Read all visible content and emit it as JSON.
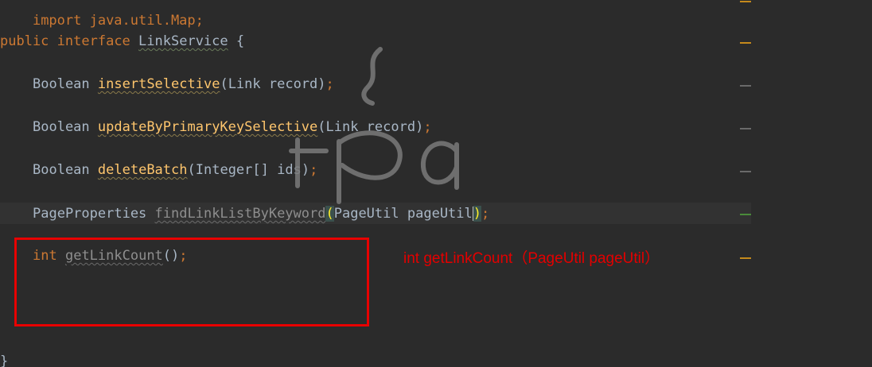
{
  "code": {
    "import_line": "import java.util.Map;",
    "decl": {
      "kw_public": "public",
      "kw_interface": "interface",
      "name": "LinkService",
      "brace": "{"
    },
    "m1": {
      "ret": "Boolean",
      "name": "insertSelective",
      "params": "Link record",
      "semi": ";"
    },
    "m2": {
      "ret": "Boolean",
      "name": "updateByPrimaryKeySelective",
      "params": "Link record",
      "semi": ";"
    },
    "m3": {
      "ret": "Boolean",
      "name": "deleteBatch",
      "params": "Integer[] ids",
      "semi": ";"
    },
    "m4": {
      "ret": "PageProperties",
      "name": "findLinkListByKeyword",
      "param_type": "PageUtil",
      "param_name": "pageUtil",
      "semi": ";"
    },
    "m5": {
      "ret": "int",
      "name": "getLinkCount",
      "params": "",
      "semi": ";"
    },
    "closing_brace": "}"
  },
  "annotation": {
    "text": "int getLinkCount（PageUtil pageUtil）",
    "color": "#e30000"
  },
  "colors": {
    "background": "#2b2b2b",
    "keyword": "#cc7832",
    "method": "#ffc66d",
    "text": "#a9b7c6",
    "unused": "#8e8e8e",
    "highlight_box": "#e80000"
  },
  "watermark": "logo (stylized steam cup and letters)"
}
